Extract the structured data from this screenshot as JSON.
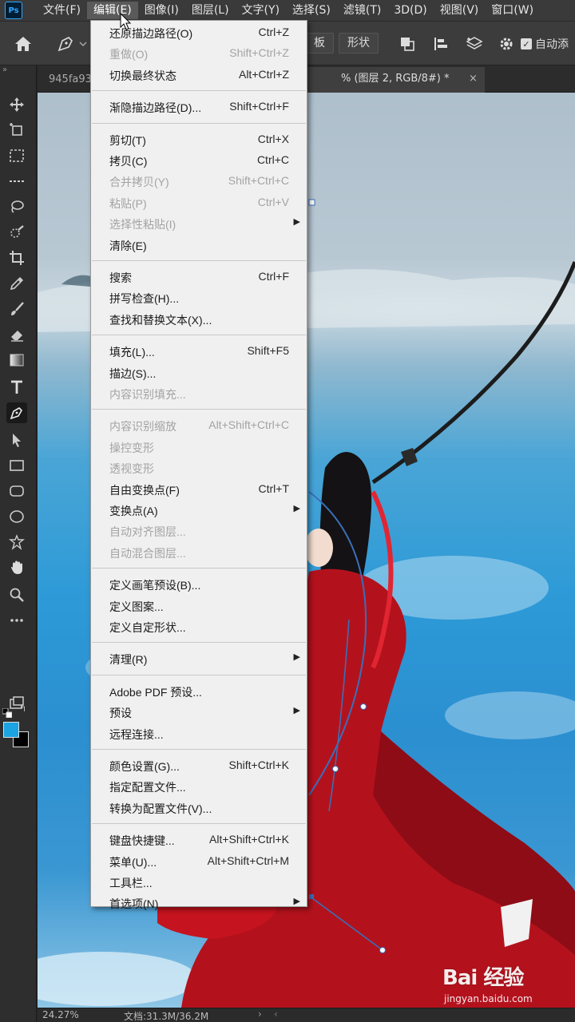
{
  "app": {
    "logo_text": "Ps"
  },
  "menubar": {
    "items": [
      {
        "label": "文件(F)"
      },
      {
        "label": "编辑(E)"
      },
      {
        "label": "图像(I)"
      },
      {
        "label": "图层(L)"
      },
      {
        "label": "文字(Y)"
      },
      {
        "label": "选择(S)"
      },
      {
        "label": "滤镜(T)"
      },
      {
        "label": "3D(D)"
      },
      {
        "label": "视图(V)"
      },
      {
        "label": "窗口(W)"
      }
    ],
    "active_index": 1
  },
  "options_bar": {
    "button_board": "板",
    "button_shape": "形状",
    "auto_add_label": "自动添",
    "auto_add_checked": true
  },
  "document": {
    "tab_inactive": "945fa93",
    "tab_active": "% (图层 2, RGB/8#) *",
    "tab_close": "×"
  },
  "status": {
    "zoom": "24.27%",
    "doc_size": "文档:31.3M/36.2M",
    "nav_next": "›",
    "nav_prev": "‹"
  },
  "colors": {
    "foreground": "#1ba3e2",
    "background": "#000000",
    "menu_bg": "#f0f0f0",
    "menu_disabled_text": "#a3a3a3",
    "ps_blue": "#31a8ff"
  },
  "watermark": {
    "brand": "Bai 经验",
    "url": "jingyan.baidu.com"
  },
  "edit_menu": {
    "items": [
      {
        "label": "还原描边路径(O)",
        "shortcut": "Ctrl+Z",
        "disabled": false,
        "submenu": false
      },
      {
        "label": "重做(O)",
        "shortcut": "Shift+Ctrl+Z",
        "disabled": true,
        "submenu": false
      },
      {
        "label": "切换最终状态",
        "shortcut": "Alt+Ctrl+Z",
        "disabled": false,
        "submenu": false
      },
      {
        "separator": true
      },
      {
        "label": "渐隐描边路径(D)...",
        "shortcut": "Shift+Ctrl+F",
        "disabled": false,
        "submenu": false
      },
      {
        "separator": true
      },
      {
        "label": "剪切(T)",
        "shortcut": "Ctrl+X",
        "disabled": false,
        "submenu": false
      },
      {
        "label": "拷贝(C)",
        "shortcut": "Ctrl+C",
        "disabled": false,
        "submenu": false
      },
      {
        "label": "合并拷贝(Y)",
        "shortcut": "Shift+Ctrl+C",
        "disabled": true,
        "submenu": false
      },
      {
        "label": "粘贴(P)",
        "shortcut": "Ctrl+V",
        "disabled": true,
        "submenu": false
      },
      {
        "label": "选择性粘贴(I)",
        "shortcut": "",
        "disabled": true,
        "submenu": true
      },
      {
        "label": "清除(E)",
        "shortcut": "",
        "disabled": false,
        "submenu": false
      },
      {
        "separator": true
      },
      {
        "label": "搜索",
        "shortcut": "Ctrl+F",
        "disabled": false,
        "submenu": false
      },
      {
        "label": "拼写检查(H)...",
        "shortcut": "",
        "disabled": false,
        "submenu": false
      },
      {
        "label": "查找和替换文本(X)...",
        "shortcut": "",
        "disabled": false,
        "submenu": false
      },
      {
        "separator": true
      },
      {
        "label": "填充(L)...",
        "shortcut": "Shift+F5",
        "disabled": false,
        "submenu": false
      },
      {
        "label": "描边(S)...",
        "shortcut": "",
        "disabled": false,
        "submenu": false
      },
      {
        "label": "内容识别填充...",
        "shortcut": "",
        "disabled": true,
        "submenu": false
      },
      {
        "separator": true
      },
      {
        "label": "内容识别缩放",
        "shortcut": "Alt+Shift+Ctrl+C",
        "disabled": true,
        "submenu": false
      },
      {
        "label": "操控变形",
        "shortcut": "",
        "disabled": true,
        "submenu": false
      },
      {
        "label": "透视变形",
        "shortcut": "",
        "disabled": true,
        "submenu": false
      },
      {
        "label": "自由变换点(F)",
        "shortcut": "Ctrl+T",
        "disabled": false,
        "submenu": false
      },
      {
        "label": "变换点(A)",
        "shortcut": "",
        "disabled": false,
        "submenu": true
      },
      {
        "label": "自动对齐图层...",
        "shortcut": "",
        "disabled": true,
        "submenu": false
      },
      {
        "label": "自动混合图层...",
        "shortcut": "",
        "disabled": true,
        "submenu": false
      },
      {
        "separator": true
      },
      {
        "label": "定义画笔预设(B)...",
        "shortcut": "",
        "disabled": false,
        "submenu": false
      },
      {
        "label": "定义图案...",
        "shortcut": "",
        "disabled": false,
        "submenu": false
      },
      {
        "label": "定义自定形状...",
        "shortcut": "",
        "disabled": false,
        "submenu": false
      },
      {
        "separator": true
      },
      {
        "label": "清理(R)",
        "shortcut": "",
        "disabled": false,
        "submenu": true
      },
      {
        "separator": true
      },
      {
        "label": "Adobe PDF 预设...",
        "shortcut": "",
        "disabled": false,
        "submenu": false
      },
      {
        "label": "预设",
        "shortcut": "",
        "disabled": false,
        "submenu": true
      },
      {
        "label": "远程连接...",
        "shortcut": "",
        "disabled": false,
        "submenu": false
      },
      {
        "separator": true
      },
      {
        "label": "颜色设置(G)...",
        "shortcut": "Shift+Ctrl+K",
        "disabled": false,
        "submenu": false
      },
      {
        "label": "指定配置文件...",
        "shortcut": "",
        "disabled": false,
        "submenu": false
      },
      {
        "label": "转换为配置文件(V)...",
        "shortcut": "",
        "disabled": false,
        "submenu": false
      },
      {
        "separator": true
      },
      {
        "label": "键盘快捷键...",
        "shortcut": "Alt+Shift+Ctrl+K",
        "disabled": false,
        "submenu": false
      },
      {
        "label": "菜单(U)...",
        "shortcut": "Alt+Shift+Ctrl+M",
        "disabled": false,
        "submenu": false
      },
      {
        "label": "工具栏...",
        "shortcut": "",
        "disabled": false,
        "submenu": false
      },
      {
        "label": "首选项(N)",
        "shortcut": "",
        "disabled": false,
        "submenu": true
      }
    ]
  }
}
